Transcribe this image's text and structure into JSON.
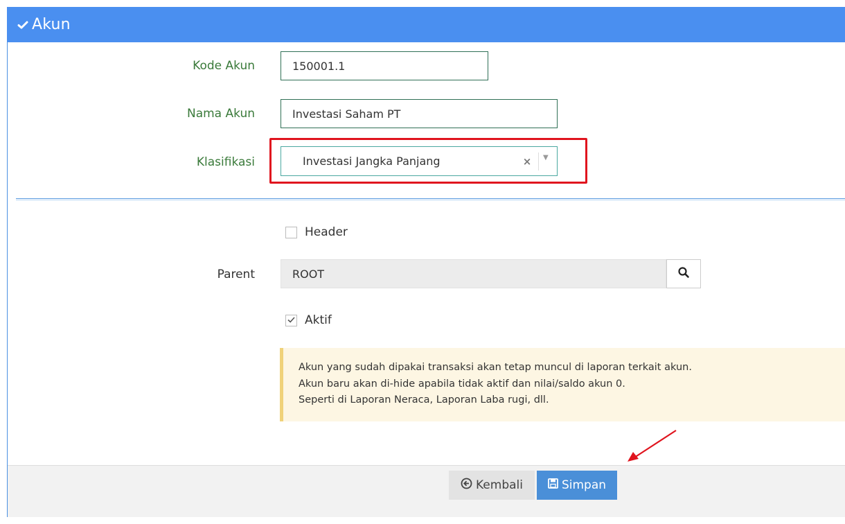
{
  "panel": {
    "title": "Akun"
  },
  "form": {
    "kode_akun": {
      "label": "Kode Akun",
      "value": "150001.1"
    },
    "nama_akun": {
      "label": "Nama Akun",
      "value": "Investasi Saham PT"
    },
    "klasifikasi": {
      "label": "Klasifikasi",
      "value": "Investasi Jangka Panjang",
      "clear_glyph": "×",
      "arrow_glyph": "▼"
    },
    "header": {
      "label": "Header",
      "checked": false
    },
    "parent": {
      "label": "Parent",
      "value": "ROOT"
    },
    "aktif": {
      "label": "Aktif",
      "checked": true
    }
  },
  "alert": {
    "lines": [
      "Akun yang sudah dipakai transaksi akan tetap muncul di laporan terkait akun.",
      "Akun baru akan di-hide apabila tidak aktif dan nilai/saldo akun 0.",
      "Seperti di Laporan Neraca, Laporan Laba rugi, dll."
    ]
  },
  "buttons": {
    "back": "Kembali",
    "save": "Simpan"
  },
  "colors": {
    "header_bg": "#4a8ff0",
    "label_green": "#3a7a3a",
    "highlight_red": "#e0141e",
    "save_btn": "#4a8fd8",
    "alert_bg": "#fdf6e3"
  },
  "icons": {
    "header": "check-icon",
    "parent_search": "search-icon",
    "back": "arrow-circle-left-icon",
    "save": "floppy-disk-icon"
  }
}
